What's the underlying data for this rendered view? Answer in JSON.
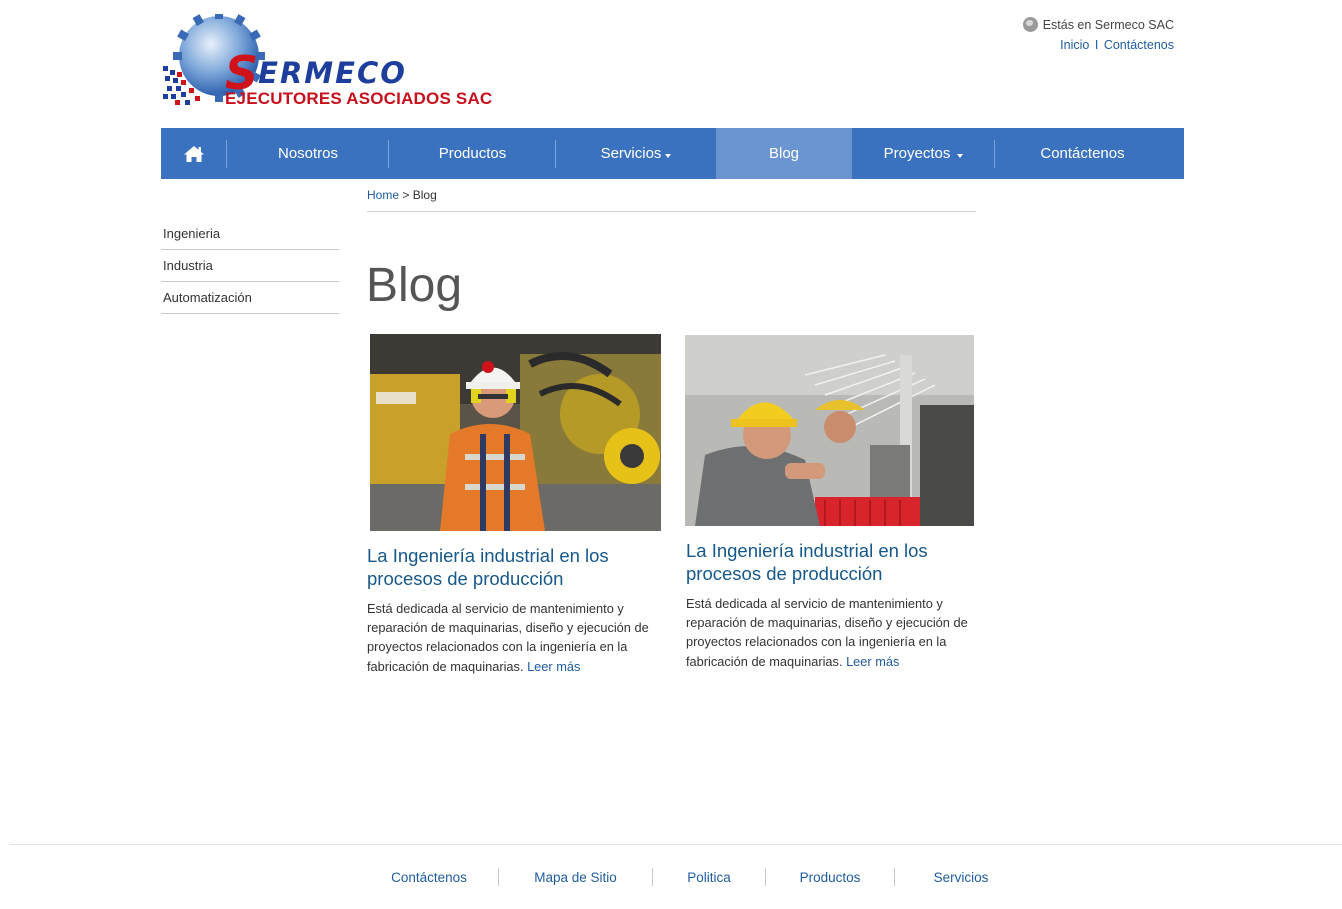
{
  "brand": {
    "name_first": "S",
    "name_rest": "ERMECO",
    "tagline": "EJECUTORES ASOCIADOS SAC",
    "colors": {
      "blue": "#1d3e9c",
      "red": "#c8101c",
      "nav": "#3b72c0",
      "nav_active": "#6b95d1"
    }
  },
  "top_info": {
    "location_text": "Estás en Sermeco SAC",
    "link_home": "Inicio",
    "separator": "I",
    "link_contact": "Contáctenos"
  },
  "nav": {
    "home_icon": "home-icon",
    "items": [
      {
        "label": "Nosotros",
        "dropdown": false
      },
      {
        "label": "Productos",
        "dropdown": false
      },
      {
        "label": "Servicios",
        "dropdown": true
      },
      {
        "label": "Blog",
        "dropdown": false,
        "active": true
      },
      {
        "label": "Proyectos",
        "dropdown": true
      },
      {
        "label": "Contáctenos",
        "dropdown": false
      }
    ]
  },
  "breadcrumb": {
    "home": "Home",
    "separator": ">",
    "current": "Blog"
  },
  "sidebar": {
    "items": [
      "Ingenieria",
      "Industria",
      "Automatización"
    ]
  },
  "page": {
    "title": "Blog"
  },
  "posts": [
    {
      "title": "La Ingeniería industrial en los procesos de producción",
      "excerpt": "Está dedicada al servicio de mantenimiento y reparación de maquinarias, diseño y ejecución de proyectos relacionados con la ingeniería en la fabricación de maquinarias.",
      "read_more": "Leer más"
    },
    {
      "title": "La Ingeniería industrial en los procesos de producción",
      "excerpt": "Está dedicada al servicio de mantenimiento y reparación de maquinarias, diseño y ejecución de proyectos relacionados con la ingeniería en la fabricación de maquinarias.",
      "read_more": "Leer más"
    }
  ],
  "footer": {
    "links": [
      "Contáctenos",
      "Mapa de Sitio",
      "Politica",
      "Productos",
      "Servicios"
    ]
  }
}
